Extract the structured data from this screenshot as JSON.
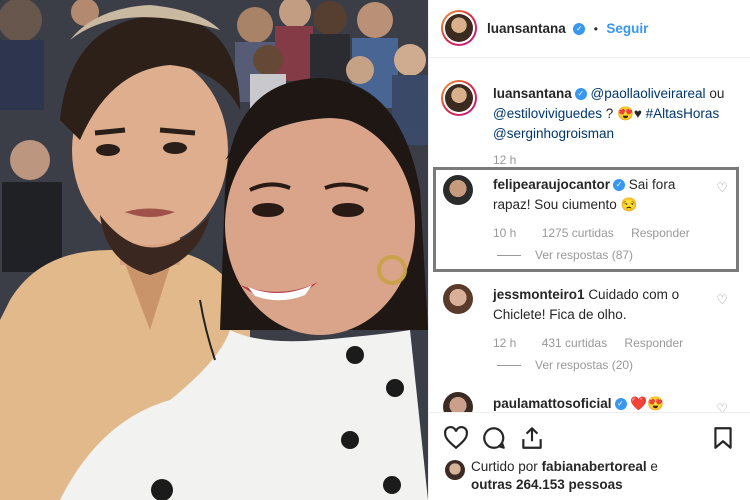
{
  "post": {
    "author": "luansantana",
    "follow_label": "Seguir",
    "separator": "•"
  },
  "caption": {
    "author": "luansantana",
    "mention1": "@paollaoliveirareal",
    "word_ou": "ou",
    "mention2": "@estiloviviguedes",
    "qmark": "?",
    "emojis": "😍♥",
    "hashtag": "#AltasHoras",
    "mention3": "@serginhogroisman",
    "time": "12 h"
  },
  "comments": [
    {
      "user": "felipearaujocantor",
      "verified": true,
      "text_line1": "Sai fora",
      "text_line2": "rapaz! Sou ciumento 😒",
      "time": "10 h",
      "likes": "1275 curtidas",
      "reply": "Responder",
      "view_replies": "Ver respostas (87)"
    },
    {
      "user": "jessmonteiro1",
      "verified": false,
      "text_line1": "Cuidado com o",
      "text_line2": "Chiclete! Fica de olho.",
      "time": "12 h",
      "likes": "431 curtidas",
      "reply": "Responder",
      "view_replies": "Ver respostas (20)"
    },
    {
      "user": "paulamattosoficial",
      "verified": true,
      "text_line1": "❤️😍",
      "text_line2": ""
    }
  ],
  "liked_by": {
    "prefix": "Curtido por",
    "user": "fabianabertoreal",
    "suffix": "e",
    "others": "outras 264.153 pessoas"
  },
  "icons": [
    "heart-icon",
    "comment-icon",
    "share-icon",
    "bookmark-icon",
    "verified-badge-icon"
  ],
  "colors": {
    "link": "#00376b",
    "follow": "#3897f0",
    "meta": "#999999",
    "highlight": "#7a7a7a"
  }
}
